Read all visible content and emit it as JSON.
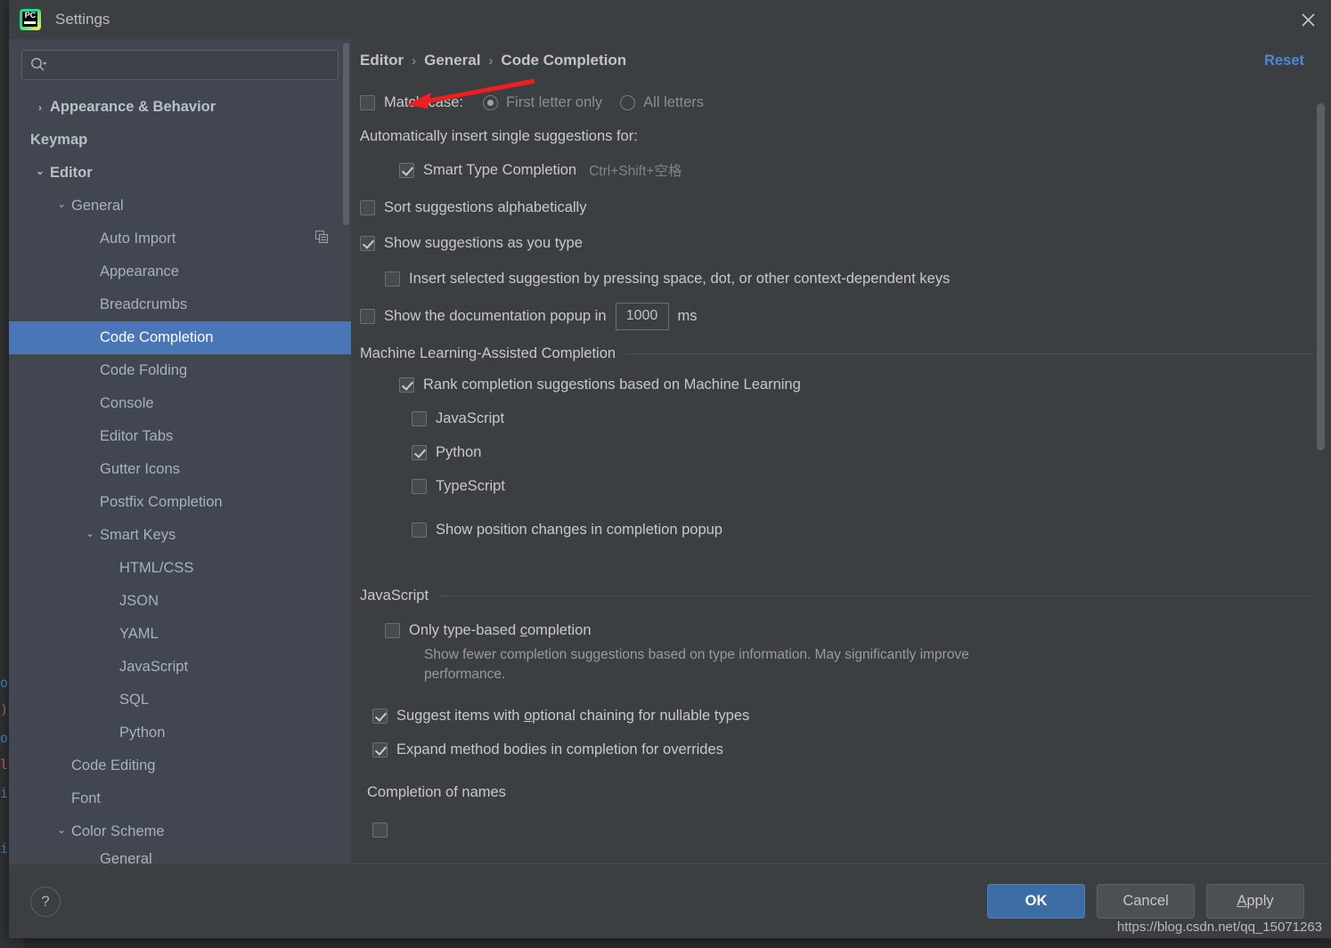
{
  "window": {
    "title": "Settings",
    "logo_text": "PC",
    "close_icon": "close-icon"
  },
  "sidebar": {
    "search": {
      "placeholder": "",
      "value": "",
      "icon": "search-icon"
    },
    "items": [
      {
        "label": "Appearance & Behavior",
        "indent": 0,
        "arrow": "collapsed",
        "bold": true,
        "selected": false
      },
      {
        "label": "Keymap",
        "indent": 0,
        "arrow": "none",
        "bold": true,
        "selected": false
      },
      {
        "label": "Editor",
        "indent": 0,
        "arrow": "expanded",
        "bold": true,
        "selected": false
      },
      {
        "label": "General",
        "indent": 1,
        "arrow": "expanded",
        "bold": false,
        "selected": false
      },
      {
        "label": "Auto Import",
        "indent": 2,
        "arrow": "none",
        "bold": false,
        "selected": false,
        "trailing_icon": "copy-icon"
      },
      {
        "label": "Appearance",
        "indent": 2,
        "arrow": "none",
        "bold": false,
        "selected": false
      },
      {
        "label": "Breadcrumbs",
        "indent": 2,
        "arrow": "none",
        "bold": false,
        "selected": false
      },
      {
        "label": "Code Completion",
        "indent": 2,
        "arrow": "none",
        "bold": false,
        "selected": true
      },
      {
        "label": "Code Folding",
        "indent": 2,
        "arrow": "none",
        "bold": false,
        "selected": false
      },
      {
        "label": "Console",
        "indent": 2,
        "arrow": "none",
        "bold": false,
        "selected": false
      },
      {
        "label": "Editor Tabs",
        "indent": 2,
        "arrow": "none",
        "bold": false,
        "selected": false
      },
      {
        "label": "Gutter Icons",
        "indent": 2,
        "arrow": "none",
        "bold": false,
        "selected": false
      },
      {
        "label": "Postfix Completion",
        "indent": 2,
        "arrow": "none",
        "bold": false,
        "selected": false
      },
      {
        "label": "Smart Keys",
        "indent": 2,
        "arrow": "expanded",
        "bold": false,
        "selected": false
      },
      {
        "label": "HTML/CSS",
        "indent": 3,
        "arrow": "none",
        "bold": false,
        "selected": false
      },
      {
        "label": "JSON",
        "indent": 3,
        "arrow": "none",
        "bold": false,
        "selected": false
      },
      {
        "label": "YAML",
        "indent": 3,
        "arrow": "none",
        "bold": false,
        "selected": false
      },
      {
        "label": "JavaScript",
        "indent": 3,
        "arrow": "none",
        "bold": false,
        "selected": false
      },
      {
        "label": "SQL",
        "indent": 3,
        "arrow": "none",
        "bold": false,
        "selected": false
      },
      {
        "label": "Python",
        "indent": 3,
        "arrow": "none",
        "bold": false,
        "selected": false
      },
      {
        "label": "Code Editing",
        "indent": 1,
        "arrow": "none",
        "bold": false,
        "selected": false
      },
      {
        "label": "Font",
        "indent": 1,
        "arrow": "none",
        "bold": false,
        "selected": false
      },
      {
        "label": "Color Scheme",
        "indent": 1,
        "arrow": "expanded",
        "bold": false,
        "selected": false
      },
      {
        "label": "General",
        "indent": 2,
        "arrow": "none",
        "bold": false,
        "selected": false,
        "cut_off": true
      }
    ]
  },
  "main": {
    "breadcrumb": [
      "Editor",
      "General",
      "Code Completion"
    ],
    "breadcrumb_separator": "›",
    "reset_label": "Reset",
    "match_case": {
      "label": "Match case:",
      "checked": false,
      "options": [
        {
          "label": "First letter only",
          "selected": true
        },
        {
          "label": "All letters",
          "selected": false
        }
      ]
    },
    "auto_insert_header": "Automatically insert single suggestions for:",
    "smart_type": {
      "label": "Smart Type Completion",
      "shortcut": "Ctrl+Shift+空格",
      "checked": true
    },
    "sort_alpha": {
      "label": "Sort suggestions alphabetically",
      "checked": false
    },
    "show_as_type": {
      "label": "Show suggestions as you type",
      "checked": true
    },
    "insert_selected": {
      "label": "Insert selected suggestion by pressing space, dot, or other context-dependent keys",
      "checked": false
    },
    "doc_popup": {
      "prefix": "Show the documentation popup in",
      "value": "1000",
      "suffix": "ms",
      "checked": false
    },
    "ml_section": {
      "title": "Machine Learning-Assisted Completion",
      "rank": {
        "label": "Rank completion suggestions based on Machine Learning",
        "checked": true
      },
      "languages": [
        {
          "label": "JavaScript",
          "checked": false
        },
        {
          "label": "Python",
          "checked": true
        },
        {
          "label": "TypeScript",
          "checked": false
        }
      ],
      "show_position": {
        "label": "Show position changes in completion popup",
        "checked": false
      }
    },
    "js_section": {
      "title": "JavaScript",
      "only_type_based": {
        "label": "Only type-based completion",
        "checked": false,
        "description": "Show fewer completion suggestions based on type information. May significantly improve performance."
      },
      "optional_chaining": {
        "label": "Suggest items with optional chaining for nullable types",
        "checked": true
      },
      "expand_method": {
        "label": "Expand method bodies in completion for overrides",
        "checked": true
      },
      "completion_of_names": "Completion of names"
    }
  },
  "footer": {
    "help_label": "?",
    "ok_label": "OK",
    "cancel_label": "Cancel",
    "apply_label": "Apply",
    "watermark": "https://blog.csdn.net/qq_15071263"
  },
  "colors": {
    "accent_blue": "#4a88d8",
    "selection_blue": "#4a76b8",
    "primary_button": "#3c6ea5",
    "annotation_red": "#f01f1f",
    "panel_bg": "#3c3f41",
    "sidebar_bg": "#414650"
  }
}
